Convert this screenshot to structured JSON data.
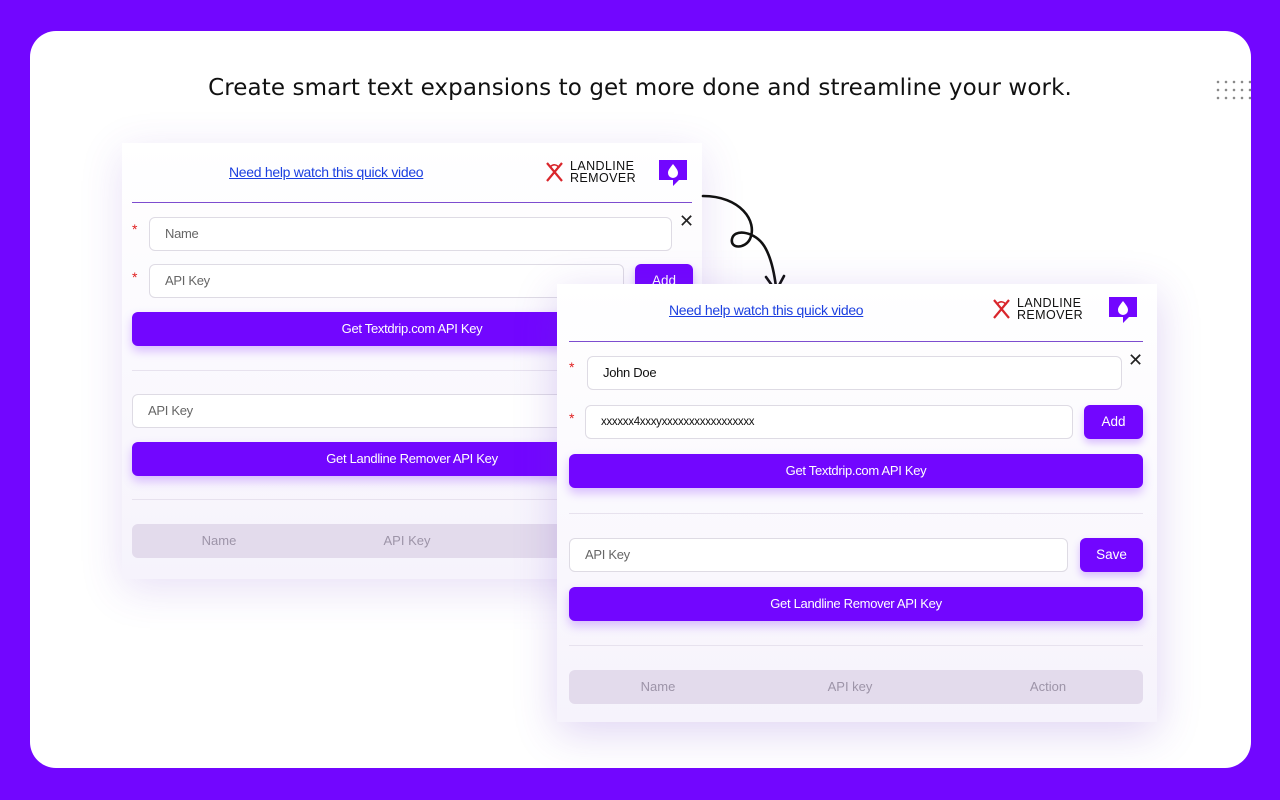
{
  "headline": "Create smart text expansions to get more done and streamline your work.",
  "brand": {
    "line1": "LANDLINE",
    "line2": "REMOVER"
  },
  "colors": {
    "background": "#7206ff",
    "accent": "#7206ff",
    "link": "#1b3fe0",
    "required": "#e02020"
  },
  "back_panel": {
    "help_link": "Need help watch this quick video",
    "name_placeholder": "Name",
    "api_key_placeholder": "API Key",
    "add_label": "Add",
    "textdrip_button": "Get Textdrip.com API Key",
    "landline_key_placeholder": "API Key",
    "landline_button": "Get Landline Remover API Key",
    "table_headers": [
      "Name",
      "API Key"
    ]
  },
  "front_panel": {
    "help_link": "Need help watch this quick video",
    "name_value": "John Doe",
    "api_key_value": "xxxxxx4xxxyxxxxxxxxxxxxxxxxx",
    "add_label": "Add",
    "textdrip_button": "Get Textdrip.com API Key",
    "landline_key_placeholder": "API Key",
    "save_label": "Save",
    "landline_button": "Get Landline Remover API Key",
    "table_headers": [
      "Name",
      "API key",
      "Action"
    ]
  },
  "icons": {
    "close": "close-icon",
    "chat": "chat-drop-icon",
    "brand_mark": "landline-remover-logo-icon",
    "arrow": "curved-arrow-icon"
  }
}
